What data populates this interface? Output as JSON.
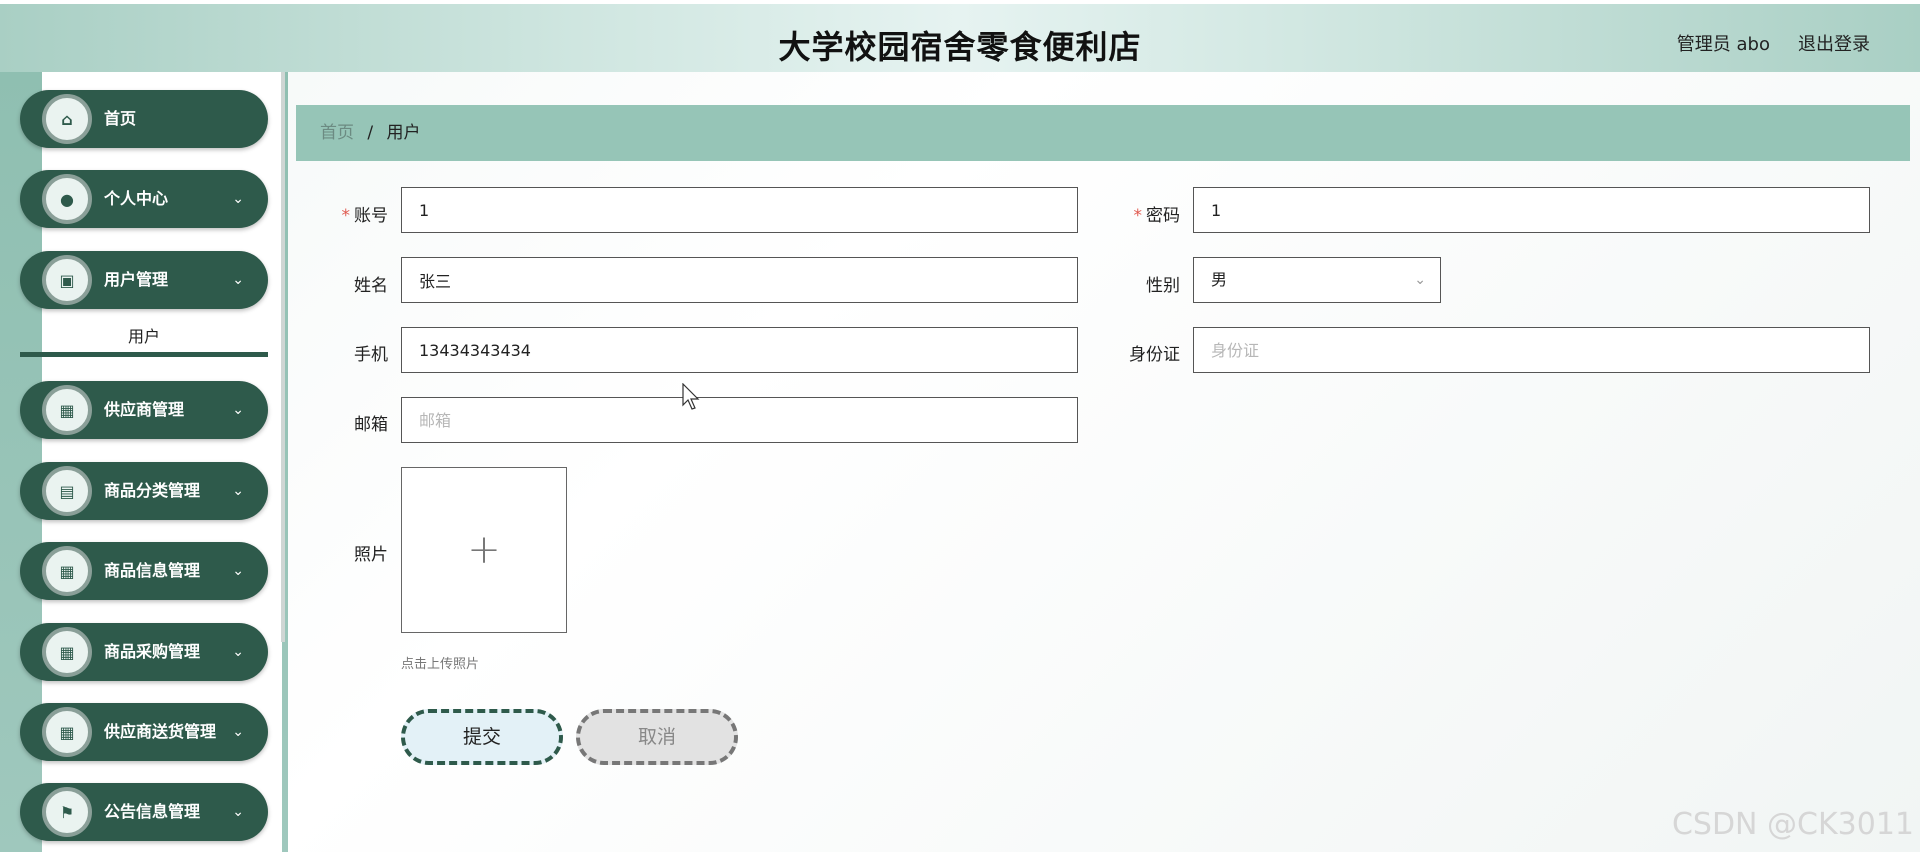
{
  "header": {
    "title": "大学校园宿舍零食便利店",
    "user": "管理员 abo",
    "logout": "退出登录"
  },
  "sidebar": {
    "items": [
      {
        "label": "首页",
        "icon": "home-icon",
        "glyph": "⌂",
        "chevron": ""
      },
      {
        "label": "个人中心",
        "icon": "person-icon",
        "glyph": "●",
        "chevron": "⌄"
      },
      {
        "label": "用户管理",
        "icon": "chart-icon",
        "glyph": "▣",
        "chevron": "⌄"
      },
      {
        "label": "供应商管理",
        "icon": "grid-icon",
        "glyph": "▦",
        "chevron": "⌄"
      },
      {
        "label": "商品分类管理",
        "icon": "clipboard-icon",
        "glyph": "▤",
        "chevron": "⌄"
      },
      {
        "label": "商品信息管理",
        "icon": "grid-icon",
        "glyph": "▦",
        "chevron": "⌄"
      },
      {
        "label": "商品采购管理",
        "icon": "grid-icon",
        "glyph": "▦",
        "chevron": "⌄"
      },
      {
        "label": "供应商送货管理",
        "icon": "grid-icon",
        "glyph": "▦",
        "chevron": "⌄"
      },
      {
        "label": "公告信息管理",
        "icon": "flag-icon",
        "glyph": "⚑",
        "chevron": "⌄"
      }
    ],
    "submenu": {
      "label": "用户"
    }
  },
  "breadcrumb": {
    "home": "首页",
    "separator": "/",
    "current": "用户"
  },
  "form": {
    "account": {
      "label": "账号",
      "value": "1",
      "required": "*"
    },
    "password": {
      "label": "密码",
      "value": "1",
      "required": "*"
    },
    "name": {
      "label": "姓名",
      "value": "张三"
    },
    "gender": {
      "label": "性别",
      "value": "男"
    },
    "phone": {
      "label": "手机",
      "value": "13434343434"
    },
    "id_card": {
      "label": "身份证",
      "placeholder": "身份证"
    },
    "email": {
      "label": "邮箱",
      "placeholder": "邮箱"
    },
    "photo": {
      "label": "照片",
      "plus": "+",
      "hint": "点击上传照片"
    }
  },
  "buttons": {
    "submit": "提交",
    "cancel": "取消"
  },
  "watermark": "CSDN @CK3011",
  "colors": {
    "primary": "#2e5a4b",
    "breadcrumb_bg": "#96c5b7",
    "required": "#e05a4f"
  }
}
